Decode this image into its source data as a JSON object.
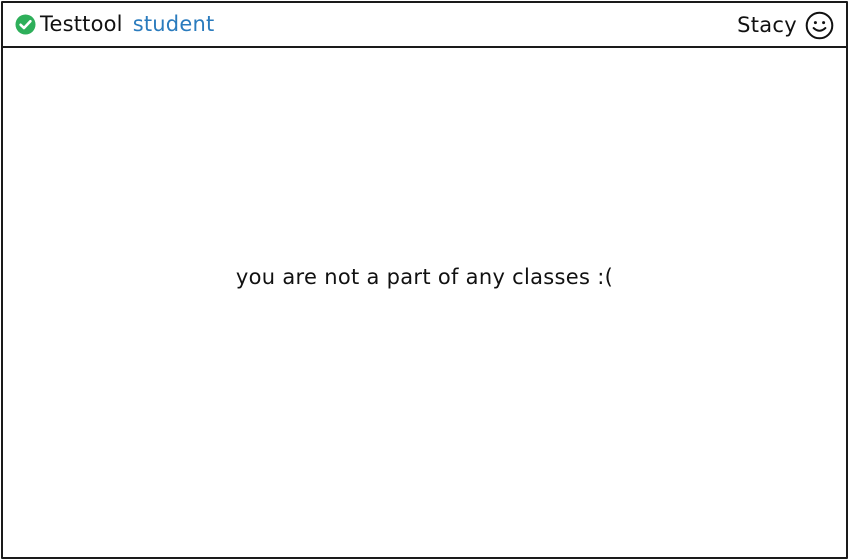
{
  "header": {
    "brand_name": "Testtool",
    "brand_role": "student",
    "brand_icon": "check-circle-icon",
    "user_name": "Stacy",
    "user_icon": "smiley-face-icon"
  },
  "main": {
    "empty_message": "you are not a part of any classes :("
  },
  "colors": {
    "brand_check": "#2eaf5a",
    "role_text": "#2a7bbd",
    "border": "#1a1a1a",
    "text": "#111111"
  }
}
